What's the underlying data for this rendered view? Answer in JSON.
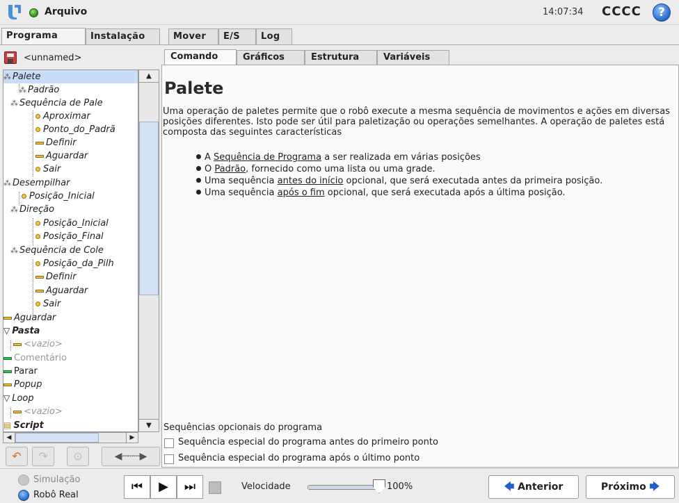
{
  "topbar": {
    "title": "Arquivo",
    "clock": "14:07:34",
    "robot_name": "CCCC",
    "help": "?"
  },
  "main_tabs": [
    {
      "label": "Programa",
      "active": true
    },
    {
      "label": "Instalação",
      "active": false
    },
    {
      "label": "Mover",
      "active": false
    },
    {
      "label": "E/S",
      "active": false
    },
    {
      "label": "Log",
      "active": false
    }
  ],
  "program": {
    "name": "<unnamed>"
  },
  "tree": [
    {
      "label": "Palete",
      "icon": "pallet-icon",
      "selected": true
    },
    {
      "label": "Padrão",
      "icon": "pattern-icon"
    },
    {
      "label": "Sequência de Pale",
      "icon": "sequence-icon"
    },
    {
      "label": "Aproximar",
      "icon": "waypoint-icon"
    },
    {
      "label": "Ponto_do_Padrã",
      "icon": "waypoint-icon"
    },
    {
      "label": "Definir",
      "icon": "set-icon"
    },
    {
      "label": "Aguardar",
      "icon": "wait-icon"
    },
    {
      "label": "Sair",
      "icon": "waypoint-icon"
    },
    {
      "label": "Desempilhar",
      "icon": "destack-icon"
    },
    {
      "label": "Posição_Inicial",
      "icon": "waypoint-icon"
    },
    {
      "label": "Direção",
      "icon": "direction-icon"
    },
    {
      "label": "Posição_Inicial",
      "icon": "waypoint-icon"
    },
    {
      "label": "Posição_Final",
      "icon": "waypoint-icon"
    },
    {
      "label": "Sequência de Cole",
      "icon": "sequence-icon"
    },
    {
      "label": "Posição_da_Pilh",
      "icon": "waypoint-icon"
    },
    {
      "label": "Definir",
      "icon": "set-icon"
    },
    {
      "label": "Aguardar",
      "icon": "wait-icon"
    },
    {
      "label": "Sair",
      "icon": "waypoint-icon"
    },
    {
      "label": "Aguardar",
      "icon": "wait-icon"
    },
    {
      "label": "Pasta",
      "icon": "folder-icon"
    },
    {
      "label": "<vazio>",
      "icon": "empty-icon"
    },
    {
      "label": "Comentário",
      "icon": "comment-icon"
    },
    {
      "label": "Parar",
      "icon": "halt-icon"
    },
    {
      "label": "Popup",
      "icon": "popup-icon"
    },
    {
      "label": "Loop",
      "icon": "loop-icon"
    },
    {
      "label": "<vazio>",
      "icon": "empty-icon"
    },
    {
      "label": "Script",
      "icon": "script-icon"
    }
  ],
  "content_tabs": [
    {
      "label": "Comando",
      "active": true
    },
    {
      "label": "Gráficos",
      "active": false
    },
    {
      "label": "Estrutura",
      "active": false
    },
    {
      "label": "Variáveis",
      "active": false
    }
  ],
  "content": {
    "title": "Palete",
    "description": "Uma operação de paletes permite que o robô execute a mesma sequência de movimentos e ações em diversas posições diferentes. Isto pode ser útil para paletização ou operações semelhantes. A operação de paletes está composta das seguintes características",
    "bullets": [
      {
        "pre": "A ",
        "link": "Sequência de Programa",
        "post": " a ser realizada em várias posições"
      },
      {
        "pre": "O ",
        "link": "Padrão",
        "post": ", fornecido como uma lista ou uma grade."
      },
      {
        "pre": "Uma sequência ",
        "link": "antes do início",
        "post": " opcional, que será executada antes da primeira posição."
      },
      {
        "pre": "Uma sequência ",
        "link": "após o fim",
        "post": " opcional, que será executada após a última posição."
      }
    ],
    "optional_title": "Sequências opcionais do programa",
    "options": [
      {
        "label": "Sequência especial do programa antes do primeiro ponto",
        "checked": false
      },
      {
        "label": "Sequência especial do programa após o último ponto",
        "checked": false
      }
    ]
  },
  "footer": {
    "simulation": "Simulação",
    "real_robot": "Robô Real",
    "speed_label": "Velocidade",
    "speed_value": "100%",
    "speed_fraction": 1.0,
    "prev": "Anterior",
    "next": "Próximo"
  },
  "colors": {
    "accent_blue": "#1f63c8",
    "status_green": "#2f8a17",
    "selection": "#c8ddf8"
  }
}
